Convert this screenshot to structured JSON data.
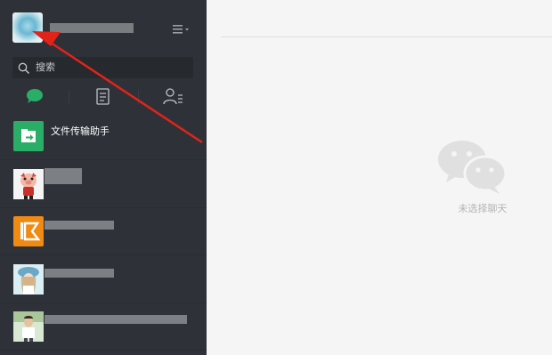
{
  "sidebar": {
    "search": {
      "placeholder": "搜索"
    },
    "tabs": [
      "chat-tab",
      "contacts-list-tab",
      "friends-tab"
    ],
    "sessions": [
      {
        "name": "文件传输助手",
        "icon": "file-transfer-icon",
        "color": "#2aae67"
      }
    ]
  },
  "main": {
    "empty_state": {
      "text": "未选择聊天"
    }
  },
  "colors": {
    "sidebar_bg": "#2e3238",
    "accent_green": "#2aae67",
    "annotation_red": "#e2231a"
  }
}
